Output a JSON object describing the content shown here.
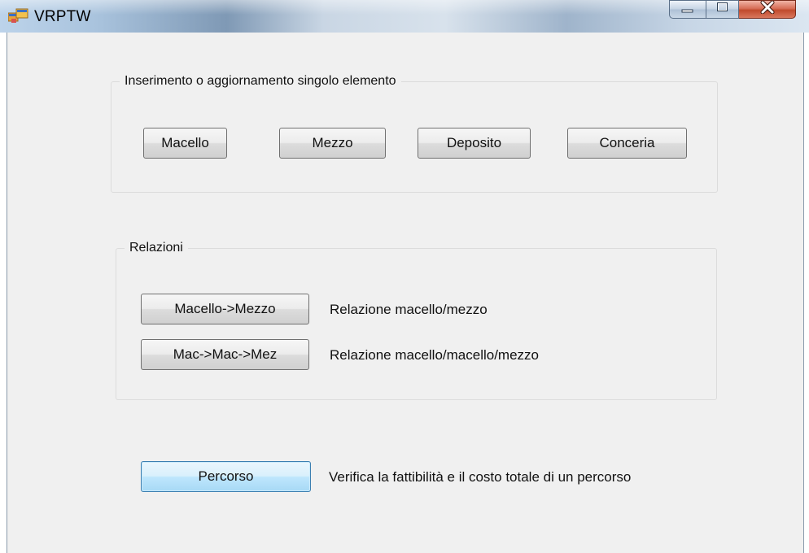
{
  "window": {
    "title": "VRPTW",
    "caption": {
      "minimize_icon": "minimize-icon",
      "maximize_icon": "maximize-icon",
      "close_icon": "close-icon"
    }
  },
  "group_elements": {
    "legend": "Inserimento o aggiornamento singolo elemento",
    "buttons": [
      "Macello",
      "Mezzo",
      "Deposito",
      "Conceria"
    ]
  },
  "group_relations": {
    "legend": "Relazioni",
    "rows": [
      {
        "button": "Macello->Mezzo",
        "description": "Relazione macello/mezzo"
      },
      {
        "button": "Mac->Mac->Mez",
        "description": "Relazione macello/macello/mezzo"
      }
    ]
  },
  "route": {
    "button": "Percorso",
    "description": "Verifica la fattibilità e il costo totale di un percorso"
  },
  "colors": {
    "client_bg": "#f0f0f0",
    "focused_button_border": "#3c7fb1",
    "close_button": "#c04a2d"
  }
}
